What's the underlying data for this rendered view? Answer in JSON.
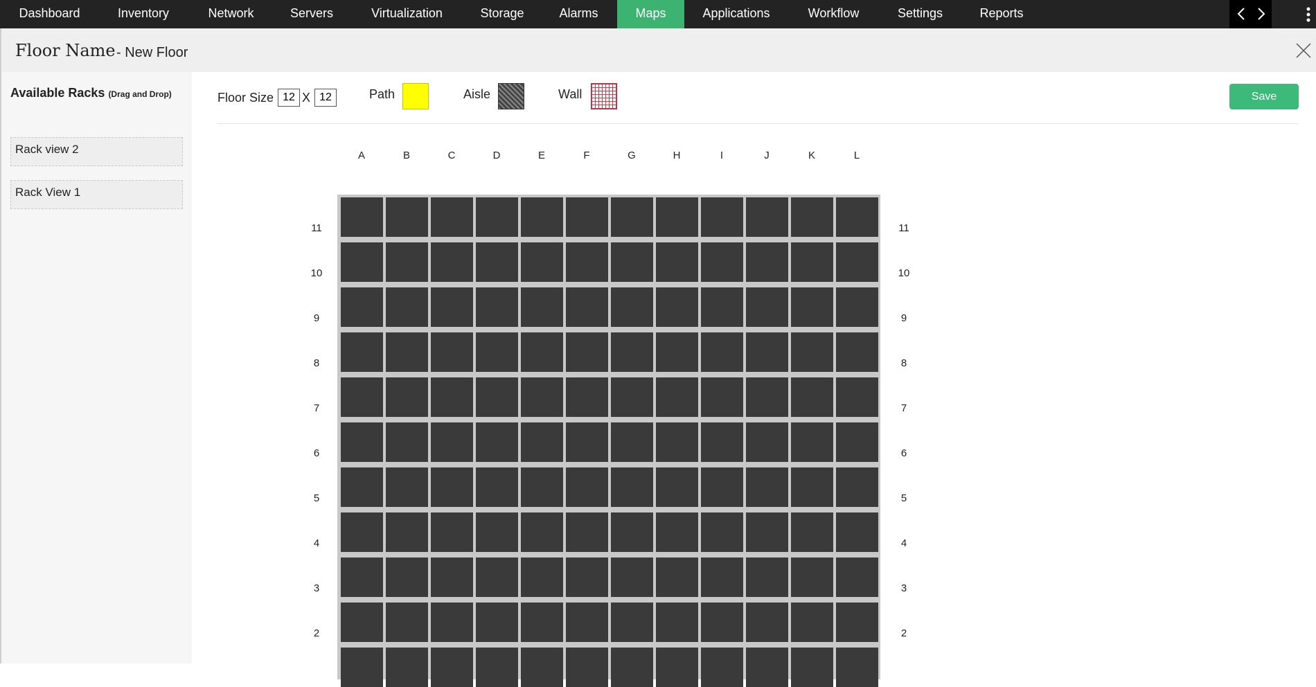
{
  "nav": {
    "items": [
      "Dashboard",
      "Inventory",
      "Network",
      "Servers",
      "Virtualization",
      "Storage",
      "Alarms",
      "Maps",
      "Applications",
      "Workflow",
      "Settings",
      "Reports"
    ],
    "active": "Maps"
  },
  "header": {
    "title": "Floor Name",
    "subtitle": "- New Floor"
  },
  "sidebar": {
    "title": "Available Racks",
    "hint": "(Drag and Drop)",
    "racks": [
      "Rack view 2",
      "Rack View 1"
    ]
  },
  "toolbar": {
    "floor_size_label": "Floor Size",
    "width_value": "12",
    "separator": "X",
    "height_value": "12",
    "path_label": "Path",
    "aisle_label": "Aisle",
    "wall_label": "Wall",
    "save_label": "Save"
  },
  "colors": {
    "nav_bg": "#232323",
    "active_tab": "#3cb371",
    "save_button": "#3dba7a",
    "path": "#ffff00",
    "cell": "#3a3a3a"
  },
  "floor": {
    "columns": [
      "A",
      "B",
      "C",
      "D",
      "E",
      "F",
      "G",
      "H",
      "I",
      "J",
      "K",
      "L"
    ],
    "rows": [
      "11",
      "10",
      "9",
      "8",
      "7",
      "6",
      "5",
      "4",
      "3",
      "2"
    ]
  }
}
